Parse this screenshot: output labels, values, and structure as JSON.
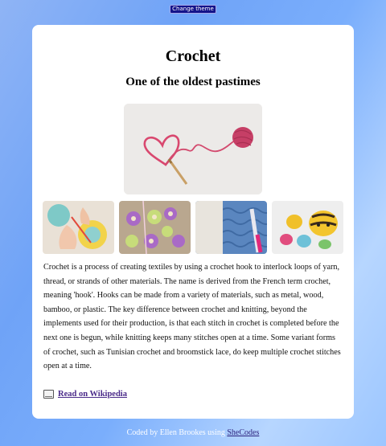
{
  "header": {
    "theme_button_label": "Change theme"
  },
  "card": {
    "title": "Crochet",
    "subtitle": "One of the oldest pastimes",
    "description": "Crochet is a process of creating textiles by using a crochet hook to interlock loops of yarn, thread, or strands of other materials. The name is derived from the French term crochet, meaning 'hook'. Hooks can be made from a variety of materials, such as metal, wood, bamboo, or plastic. The key difference between crochet and knitting, beyond the implements used for their production, is that each stitch in crochet is completed before the next one is begun, while knitting keeps many stitches open at a time. Some variant forms of crochet, such as Tunisian crochet and broomstick lace, do keep multiple crochet stitches open at a time.",
    "link_label": "Read on Wikipedia"
  },
  "footer": {
    "text": "Coded by Ellen Brookes using ",
    "link_label": "SheCodes"
  },
  "icons": {
    "link_icon": "book-icon"
  }
}
